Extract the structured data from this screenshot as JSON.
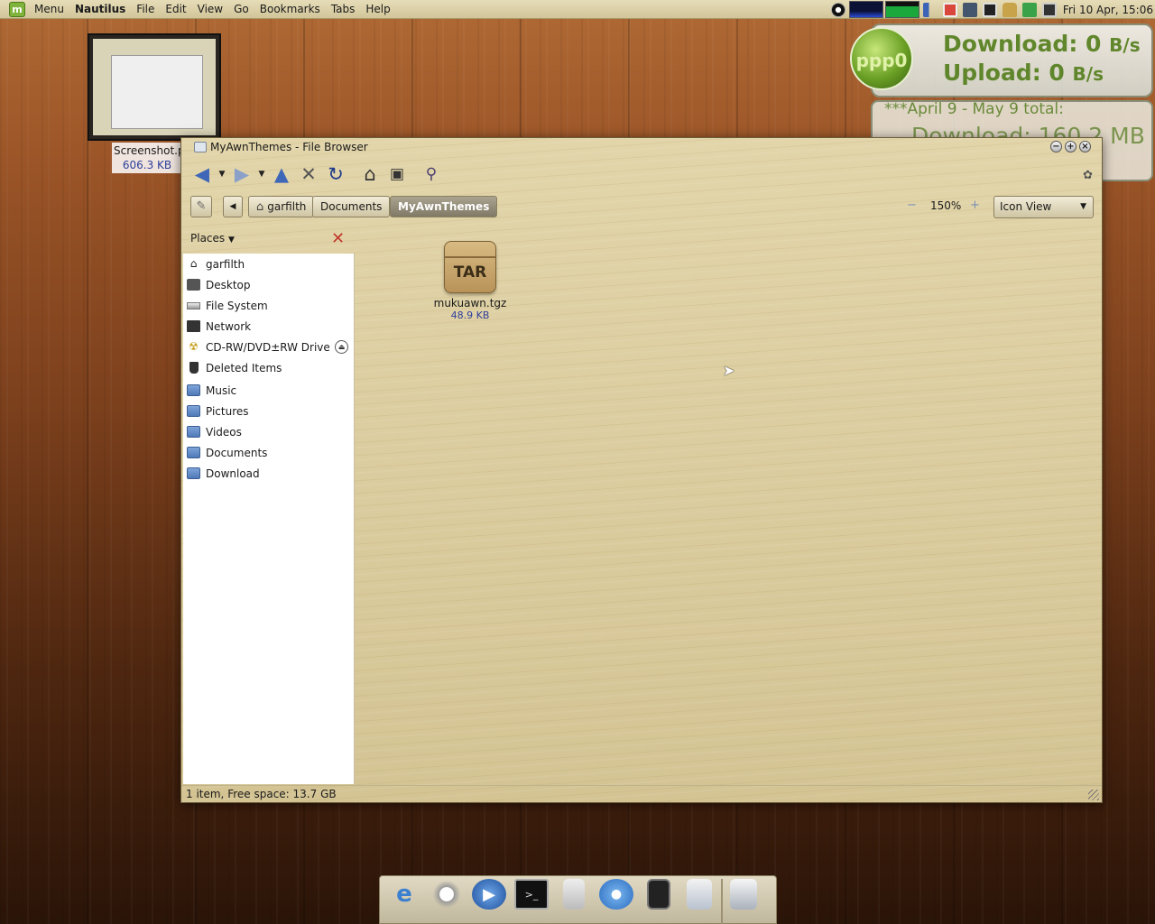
{
  "top_panel": {
    "menu_label": "Menu",
    "app_name": "Nautilus",
    "menus": [
      "File",
      "Edit",
      "View",
      "Go",
      "Bookmarks",
      "Tabs",
      "Help"
    ],
    "clock": "Fri 10 Apr, 15:06"
  },
  "desktop": {
    "icon_label": "Screenshot.p",
    "icon_size": "606.3 KB"
  },
  "conky": {
    "interface": "ppp0",
    "download_label": "Download: 0",
    "download_unit": "B/s",
    "upload_label": "Upload: 0",
    "upload_unit": "B/s",
    "period": "***April 9 - May 9 total:",
    "total_download": "Download: 160.2 MB"
  },
  "window": {
    "title": "MyAwnThemes - File Browser",
    "breadcrumbs": [
      "garfilth",
      "Documents",
      "MyAwnThemes"
    ],
    "zoom": "150%",
    "view_mode": "Icon View",
    "places_label": "Places",
    "places": [
      {
        "label": "garfilth",
        "icon": "home-icon"
      },
      {
        "label": "Desktop",
        "icon": "desktop-icon"
      },
      {
        "label": "File System",
        "icon": "drive-icon"
      },
      {
        "label": "Network",
        "icon": "network-icon"
      },
      {
        "label": "CD-RW/DVD±RW Drive",
        "icon": "optical-drive-icon"
      },
      {
        "label": "Deleted Items",
        "icon": "trash-icon"
      },
      {
        "label": "Music",
        "icon": "folder-icon"
      },
      {
        "label": "Pictures",
        "icon": "folder-icon"
      },
      {
        "label": "Videos",
        "icon": "folder-icon"
      },
      {
        "label": "Documents",
        "icon": "folder-icon"
      },
      {
        "label": "Download",
        "icon": "folder-icon"
      }
    ],
    "files": [
      {
        "name": "mukuawn.tgz",
        "size": "48.9 KB",
        "icon_text": "TAR"
      }
    ],
    "status": "1 item, Free space: 13.7 GB"
  },
  "dock": {
    "icons": [
      "epiphany-icon",
      "gimp-icon",
      "media-player-icon",
      "terminal-icon",
      "speaker-icon",
      "chat-icon",
      "notes-icon",
      "mail-icon",
      "file-manager-icon"
    ]
  }
}
